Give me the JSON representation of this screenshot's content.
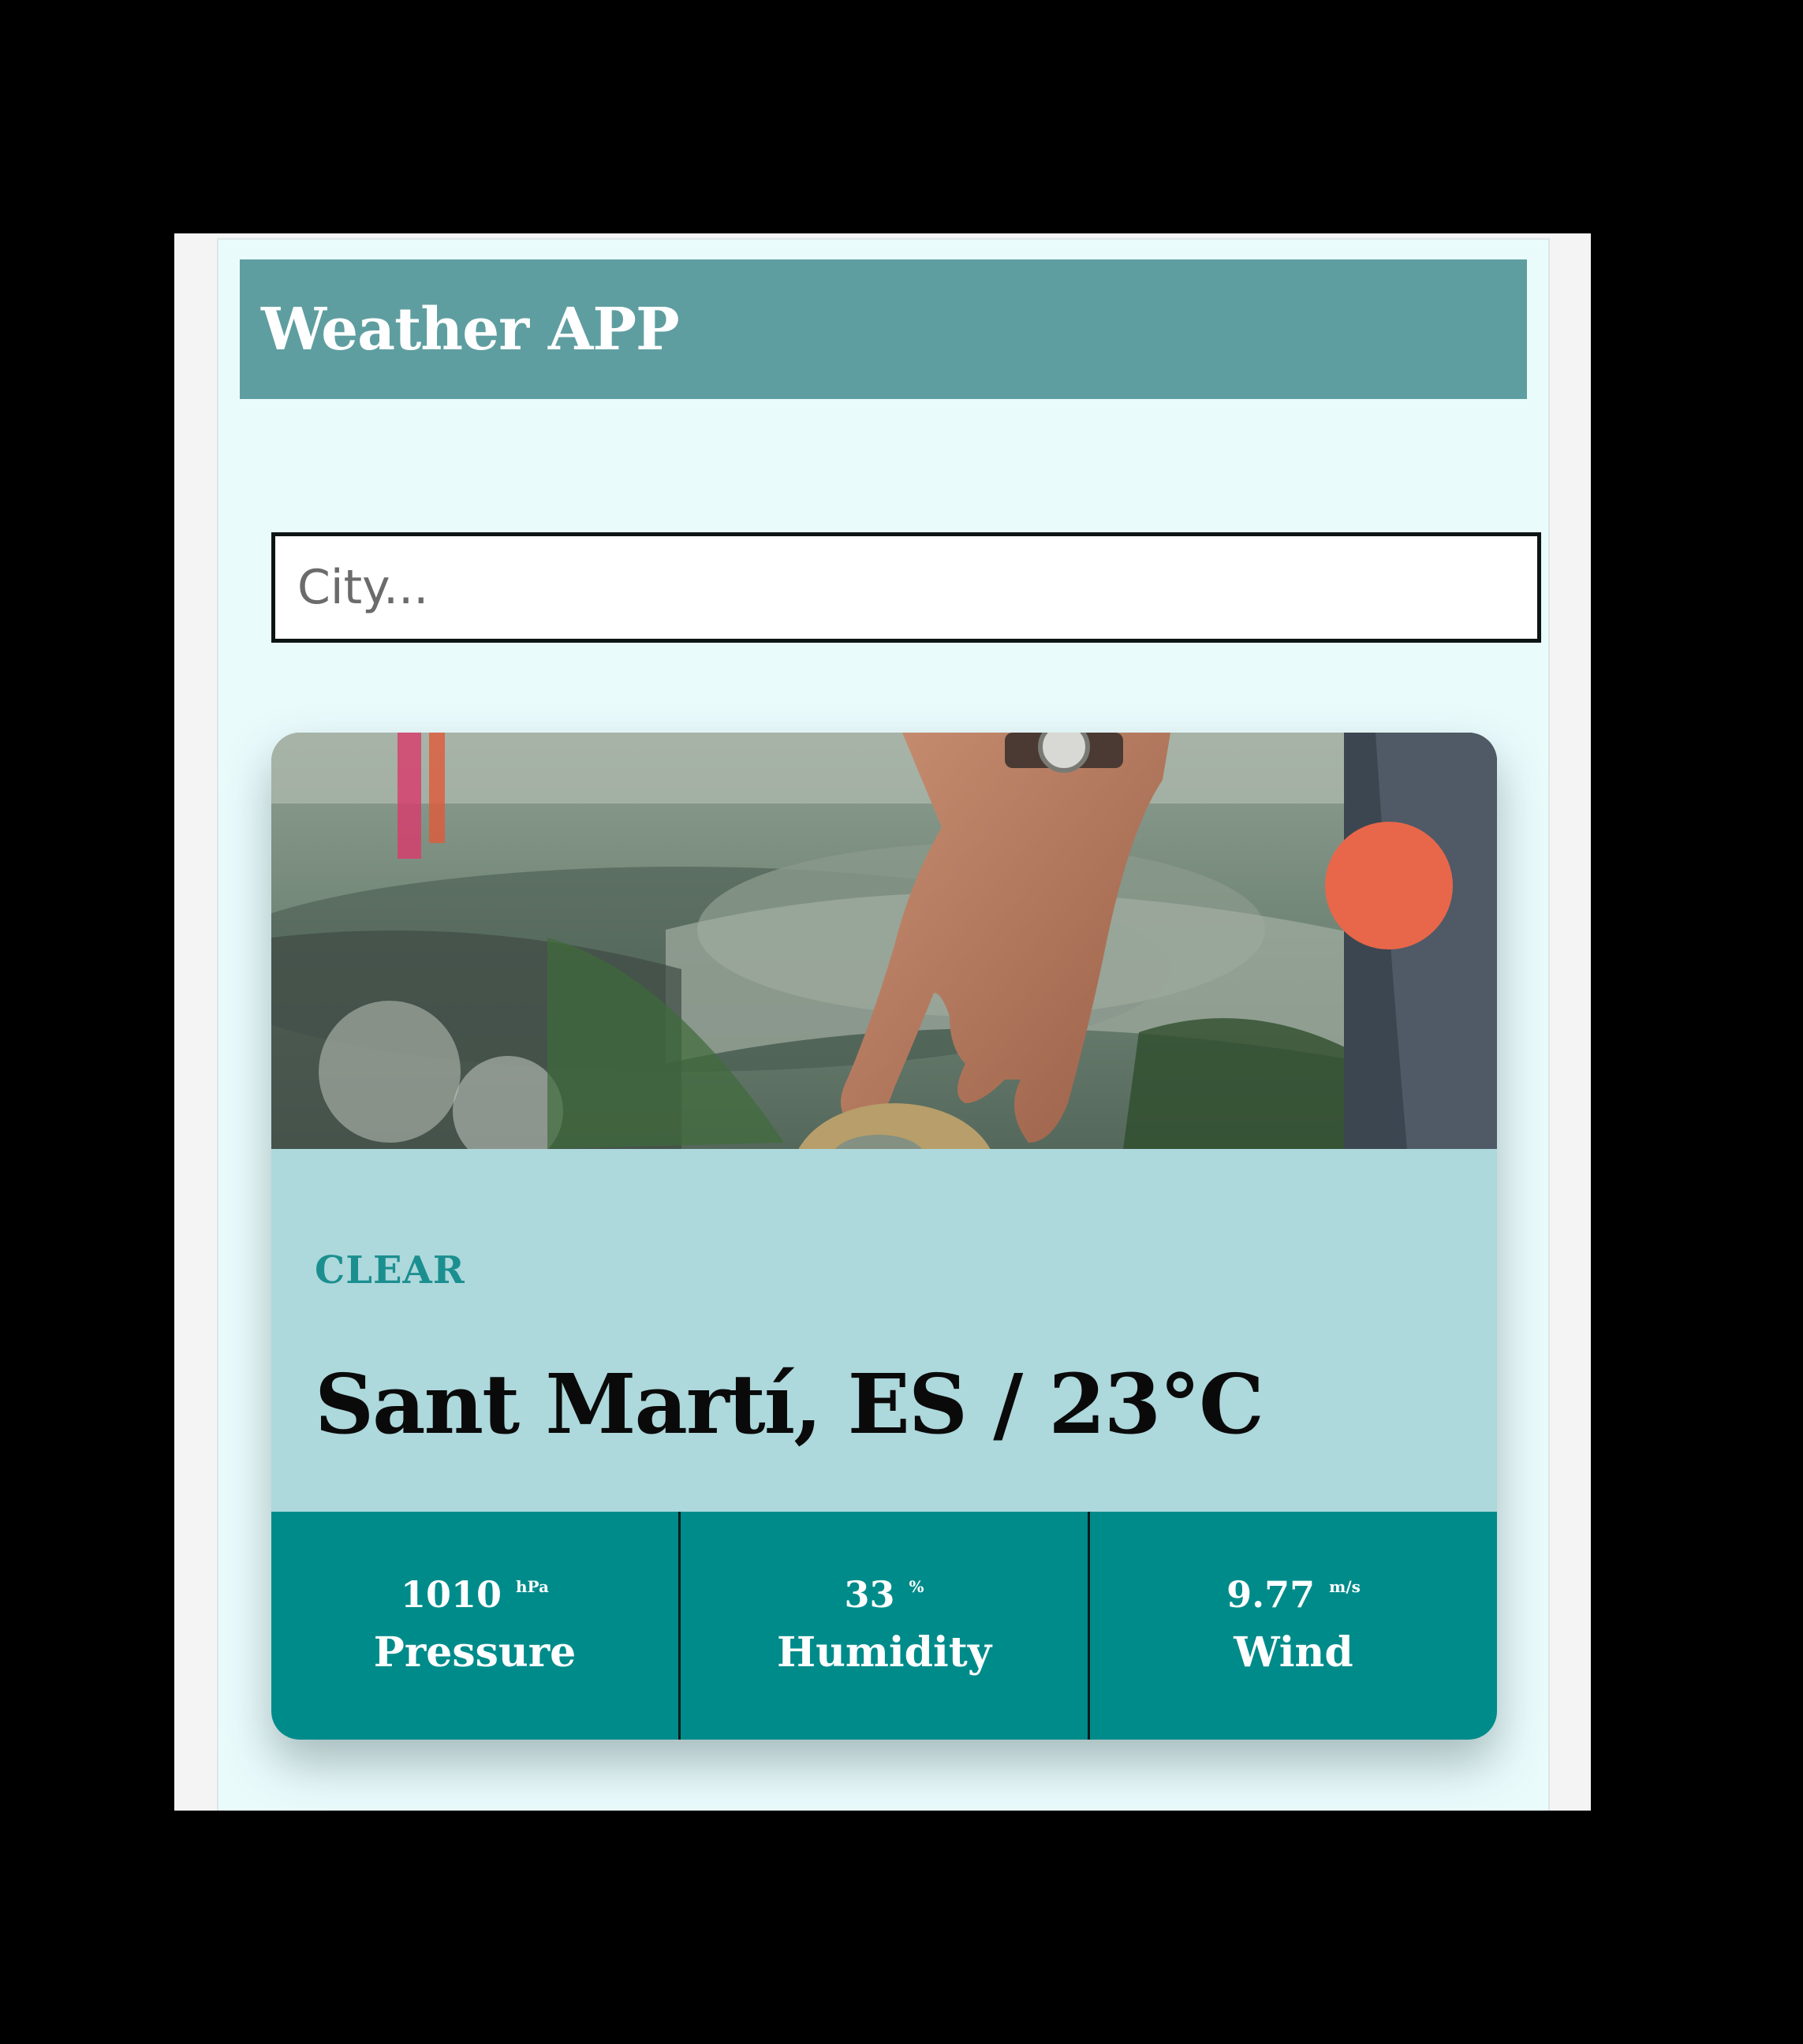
{
  "header": {
    "title": "Weather APP"
  },
  "search": {
    "placeholder": "City..."
  },
  "weather": {
    "condition": "Clear",
    "location": "Sant Martí, ES / 23°C",
    "image_description_icon": "globe-hand-photo",
    "status_dot_color": "#e8674a"
  },
  "stats": [
    {
      "value": "1010",
      "unit": "hPa",
      "label": "Pressure"
    },
    {
      "value": "33",
      "unit": "%",
      "label": "Humidity"
    },
    {
      "value": "9.77",
      "unit": "m/s",
      "label": "Wind"
    }
  ],
  "colors": {
    "header_bg": "#5f9ea0",
    "card_body": "#add8dc",
    "stats_bg": "#008b8b",
    "condition_text": "#1b8f8f",
    "page_bg": "#eafbfc"
  }
}
